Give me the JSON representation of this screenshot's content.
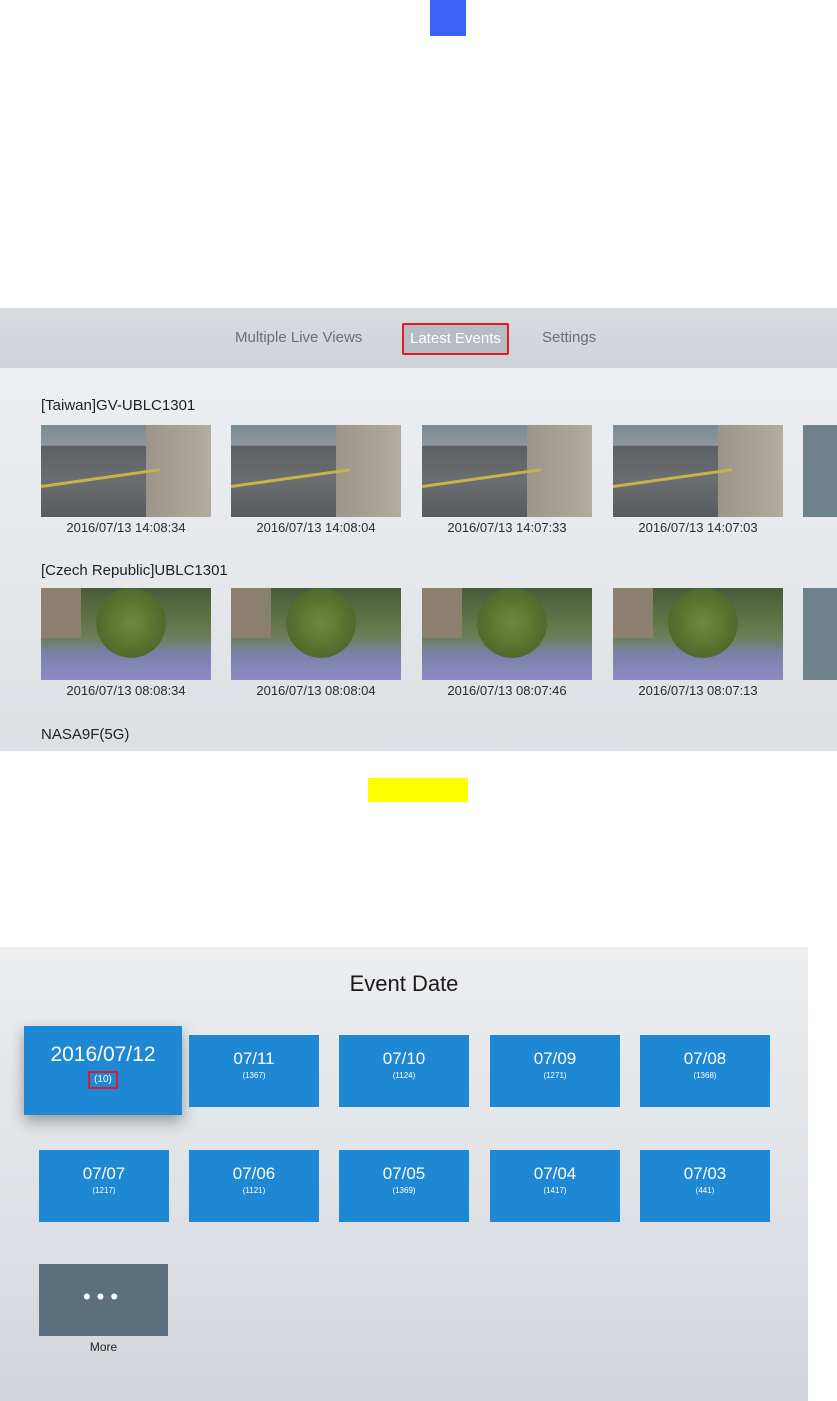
{
  "screen1": {
    "tabs": [
      {
        "label": "Multiple Live Views"
      },
      {
        "label": "Latest Events",
        "selected": true
      },
      {
        "label": "Settings"
      }
    ],
    "groups": [
      {
        "title": "[Taiwan]GV-UBLC1301",
        "events": [
          {
            "timestamp": "2016/07/13 14:08:34"
          },
          {
            "timestamp": "2016/07/13 14:08:04"
          },
          {
            "timestamp": "2016/07/13 14:07:33"
          },
          {
            "timestamp": "2016/07/13 14:07:03"
          }
        ]
      },
      {
        "title": "[Czech Republic]UBLC1301",
        "events": [
          {
            "timestamp": "2016/07/13 08:08:34"
          },
          {
            "timestamp": "2016/07/13 08:08:04"
          },
          {
            "timestamp": "2016/07/13 08:07:46"
          },
          {
            "timestamp": "2016/07/13 08:07:13"
          }
        ]
      },
      {
        "title": "NASA9F(5G)",
        "events": []
      }
    ]
  },
  "screen2": {
    "title": "Event Date",
    "dates": [
      {
        "label": "2016/07/12",
        "count": "(10)",
        "focused": true
      },
      {
        "label": "07/11",
        "count": "(1367)"
      },
      {
        "label": "07/10",
        "count": "(1124)"
      },
      {
        "label": "07/09",
        "count": "(1271)"
      },
      {
        "label": "07/08",
        "count": "(1368)"
      },
      {
        "label": "07/07",
        "count": "(1217)"
      },
      {
        "label": "07/06",
        "count": "(1121)"
      },
      {
        "label": "07/05",
        "count": "(1369)"
      },
      {
        "label": "07/04",
        "count": "(1417)"
      },
      {
        "label": "07/03",
        "count": "(441)"
      }
    ],
    "more": {
      "icon": "ellipsis-icon",
      "label": "More"
    }
  },
  "colors": {
    "accent_blue": "#1e88d4",
    "highlight_red": "#e0192c",
    "more_tile": "#5c6f7d"
  }
}
